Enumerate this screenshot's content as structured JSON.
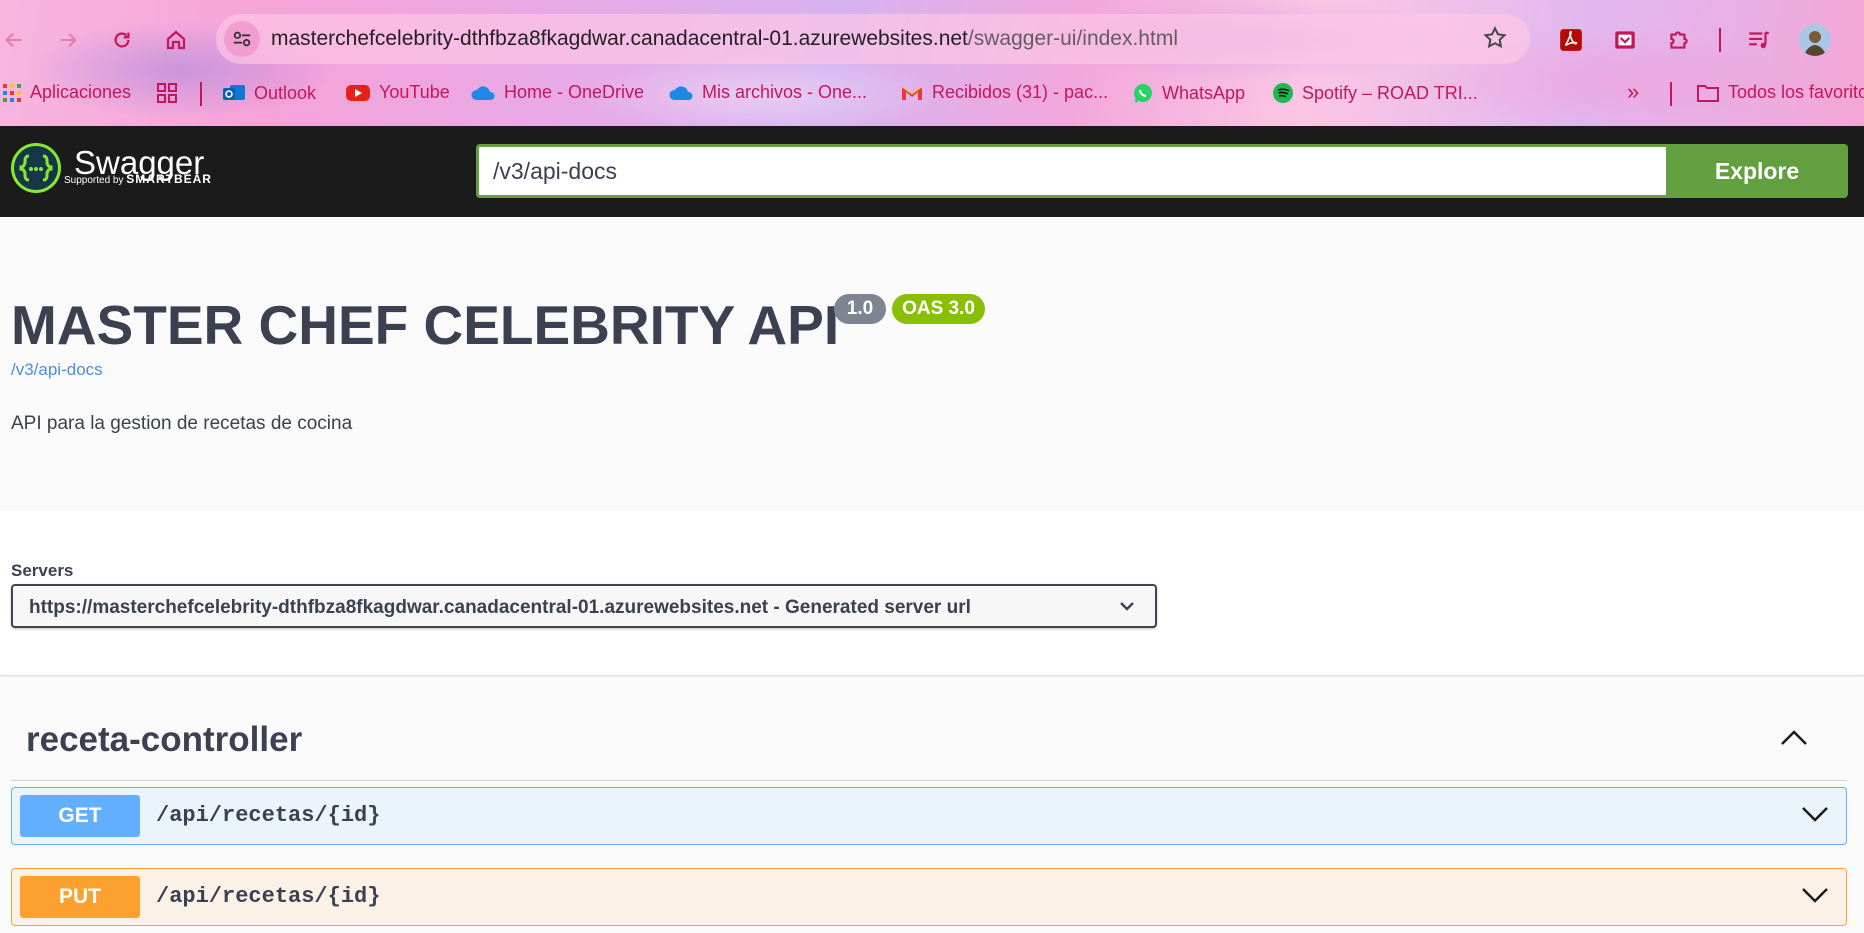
{
  "browser": {
    "url_host": "masterchefcelebrity-dthfbza8fkagdwar.canadacentral-01.azurewebsites.net",
    "url_path": "/swagger-ui/index.html",
    "bookmarks": [
      {
        "label": "Aplicaciones",
        "icon": "apps-grid-icon"
      },
      {
        "label": "",
        "icon": "grid-icon"
      },
      {
        "label": "Outlook",
        "icon": "outlook-icon"
      },
      {
        "label": "YouTube",
        "icon": "youtube-icon"
      },
      {
        "label": "Home - OneDrive",
        "icon": "onedrive-icon"
      },
      {
        "label": "Mis archivos - One...",
        "icon": "onedrive-icon"
      },
      {
        "label": "Recibidos (31) - pac...",
        "icon": "gmail-icon"
      },
      {
        "label": "WhatsApp",
        "icon": "whatsapp-icon"
      },
      {
        "label": "Spotify – ROAD TRI...",
        "icon": "spotify-icon"
      }
    ],
    "overflow_label": "»",
    "all_bookmarks_label": "Todos los favoritos",
    "accent_color": "#c2185b"
  },
  "topbar": {
    "logo_text": "Swagger",
    "logo_sub_prefix": "Supported by",
    "logo_sub_brand": "SMARTBEAR",
    "spec_url": "/v3/api-docs",
    "explore_label": "Explore"
  },
  "info": {
    "title": "MASTER CHEF CELEBRITY API",
    "version": "1.0",
    "oas": "OAS 3.0",
    "spec_link": "/v3/api-docs",
    "description": "API para la gestion de recetas de cocina"
  },
  "servers": {
    "label": "Servers",
    "selected": "https://masterchefcelebrity-dthfbza8fkagdwar.canadacentral-01.azurewebsites.net - Generated server url"
  },
  "tag": {
    "name": "receta-controller"
  },
  "operations": [
    {
      "method": "GET",
      "path": "/api/recetas/{id}",
      "color": "#61affe"
    },
    {
      "method": "PUT",
      "path": "/api/recetas/{id}",
      "color": "#fca130"
    }
  ]
}
